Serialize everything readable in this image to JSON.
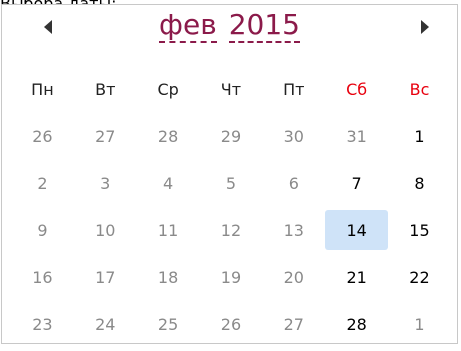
{
  "page": {
    "label": "Выбора даты:"
  },
  "calendar": {
    "month": "фев",
    "year": "2015",
    "prev_icon": "triangle-left-icon",
    "next_icon": "triangle-right-icon",
    "weekdays": [
      "Пн",
      "Вт",
      "Ср",
      "Чт",
      "Пт",
      "Сб",
      "Вс"
    ],
    "weeks": [
      [
        "26",
        "27",
        "28",
        "29",
        "30",
        "31",
        "1"
      ],
      [
        "2",
        "3",
        "4",
        "5",
        "6",
        "7",
        "8"
      ],
      [
        "9",
        "10",
        "11",
        "12",
        "13",
        "14",
        "15"
      ],
      [
        "16",
        "17",
        "18",
        "19",
        "20",
        "21",
        "22"
      ],
      [
        "23",
        "24",
        "25",
        "26",
        "27",
        "28",
        "1"
      ]
    ],
    "selected_day": "14",
    "colors": {
      "month_year": "#8b1a4a",
      "weekend_header": "#e8000e",
      "selected_bg": "#cfe3f8",
      "muted_text": "#8a8a8a",
      "border": "#c8c8c8"
    }
  }
}
